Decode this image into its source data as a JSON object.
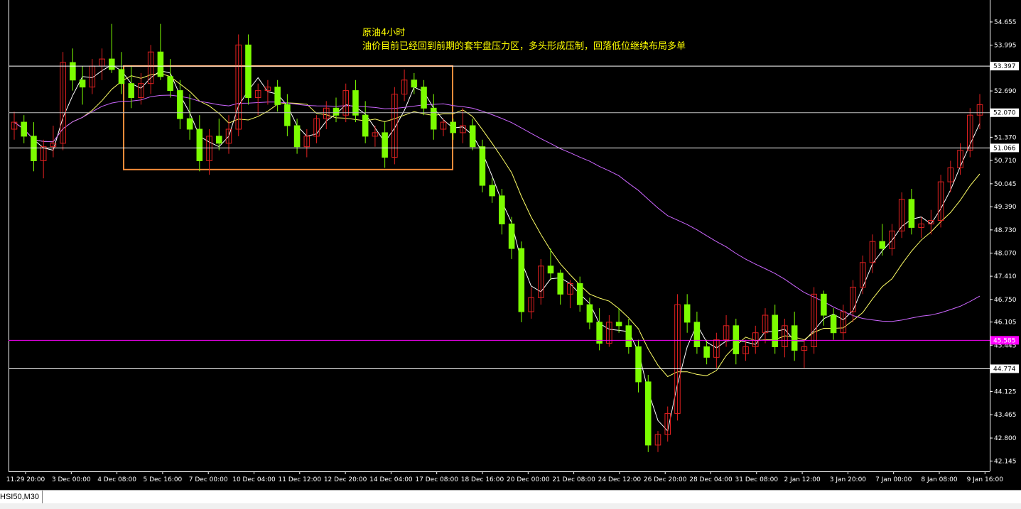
{
  "chart_data": {
    "type": "candlestick",
    "annotation": {
      "line1": "原油4小时",
      "line2": "油价目前已经回到前期的套牢盘压力区，多头形成压制，回落低位继续布局多单"
    },
    "y_ticks": [
      "54.655",
      "53.995",
      "53.397",
      "52.690",
      "52.070",
      "51.370",
      "51.066",
      "50.710",
      "50.045",
      "49.390",
      "48.730",
      "48.070",
      "47.410",
      "46.750",
      "46.105",
      "45.585",
      "45.445",
      "44.774",
      "44.125",
      "43.465",
      "42.800",
      "42.145"
    ],
    "y_ticks_plain": [
      54.655,
      53.995,
      53.335,
      52.69,
      52.03,
      51.37,
      50.71,
      50.045,
      49.39,
      48.73,
      48.07,
      47.41,
      46.75,
      46.105,
      45.445,
      44.774,
      44.125,
      43.465,
      42.8,
      42.145
    ],
    "x_labels": [
      "11.29 20:00",
      "3 Dec 00:00",
      "4 Dec 08:00",
      "5 Dec 16:00",
      "7 Dec 00:00",
      "10 Dec 04:00",
      "11 Dec 12:00",
      "12 Dec 20:00",
      "14 Dec 04:00",
      "17 Dec 08:00",
      "18 Dec 16:00",
      "20 Dec 00:00",
      "21 Dec 08:00",
      "24 Dec 12:00",
      "26 Dec 20:00",
      "28 Dec 04:00",
      "31 Dec 08:00",
      "2 Jan 12:00",
      "3 Jan 20:00",
      "7 Jan 00:00",
      "8 Jan 08:00",
      "9 Jan 16:00"
    ],
    "ylim": [
      41.85,
      55.2
    ],
    "horizontal_lines": [
      {
        "price": 53.397,
        "label": "53.397",
        "color": "#ffffff"
      },
      {
        "price": 52.07,
        "label": "52.070",
        "color": "#c0c0c0"
      },
      {
        "price": 51.066,
        "label": "51.066",
        "color": "#ffffff"
      },
      {
        "price": 45.585,
        "label": "45.585",
        "color": "#ff00ff"
      },
      {
        "price": 44.774,
        "label": "44.774",
        "color": "#ffffff"
      }
    ],
    "resistance_box": {
      "price_top": 53.4,
      "price_bottom": 50.45,
      "color": "#ff8c3a"
    },
    "ohlc": [
      [
        51.6,
        52.1,
        51.3,
        51.8
      ],
      [
        51.8,
        52.0,
        51.2,
        51.4
      ],
      [
        51.4,
        51.8,
        50.4,
        50.7
      ],
      [
        50.7,
        51.3,
        50.2,
        51.1
      ],
      [
        51.1,
        51.7,
        50.8,
        51.2
      ],
      [
        51.2,
        53.8,
        51.0,
        53.5
      ],
      [
        53.5,
        53.9,
        52.7,
        53.0
      ],
      [
        53.0,
        53.4,
        52.3,
        52.8
      ],
      [
        52.8,
        53.6,
        52.6,
        53.4
      ],
      [
        53.4,
        53.9,
        53.0,
        53.6
      ],
      [
        53.6,
        54.6,
        53.2,
        53.3
      ],
      [
        53.3,
        53.8,
        52.6,
        52.9
      ],
      [
        52.9,
        53.4,
        52.2,
        52.5
      ],
      [
        52.5,
        53.2,
        52.3,
        52.9
      ],
      [
        52.9,
        54.0,
        52.6,
        53.8
      ],
      [
        53.8,
        54.6,
        53.0,
        53.1
      ],
      [
        53.1,
        53.6,
        52.5,
        52.7
      ],
      [
        52.7,
        53.0,
        51.6,
        51.9
      ],
      [
        51.9,
        52.6,
        51.3,
        51.6
      ],
      [
        51.6,
        52.0,
        50.4,
        50.7
      ],
      [
        50.7,
        51.6,
        50.3,
        51.4
      ],
      [
        51.4,
        51.9,
        51.0,
        51.2
      ],
      [
        51.2,
        52.0,
        50.9,
        51.6
      ],
      [
        51.6,
        54.3,
        51.4,
        54.0
      ],
      [
        54.0,
        54.3,
        52.3,
        52.5
      ],
      [
        52.5,
        52.9,
        52.0,
        52.7
      ],
      [
        52.7,
        53.0,
        52.3,
        52.8
      ],
      [
        52.8,
        53.0,
        52.1,
        52.3
      ],
      [
        52.3,
        52.6,
        51.4,
        51.7
      ],
      [
        51.7,
        51.9,
        50.9,
        51.1
      ],
      [
        51.1,
        51.6,
        50.8,
        51.4
      ],
      [
        51.4,
        52.0,
        51.2,
        51.9
      ],
      [
        51.9,
        52.4,
        51.6,
        52.2
      ],
      [
        52.2,
        52.5,
        51.8,
        52.0
      ],
      [
        52.0,
        52.9,
        51.8,
        52.7
      ],
      [
        52.7,
        53.0,
        51.8,
        52.0
      ],
      [
        52.0,
        52.4,
        51.2,
        51.4
      ],
      [
        51.4,
        51.7,
        51.1,
        51.5
      ],
      [
        51.5,
        51.8,
        50.5,
        50.8
      ],
      [
        50.8,
        52.8,
        50.6,
        52.6
      ],
      [
        52.6,
        53.3,
        52.4,
        53.0
      ],
      [
        53.0,
        53.2,
        52.6,
        52.8
      ],
      [
        52.8,
        53.0,
        52.0,
        52.2
      ],
      [
        52.2,
        52.6,
        51.3,
        51.6
      ],
      [
        51.6,
        51.9,
        51.4,
        51.8
      ],
      [
        51.8,
        51.9,
        51.3,
        51.5
      ],
      [
        51.5,
        52.2,
        51.2,
        51.7
      ],
      [
        51.7,
        51.9,
        51.0,
        51.1
      ],
      [
        51.1,
        51.3,
        49.8,
        50.0
      ],
      [
        50.0,
        50.2,
        49.5,
        49.7
      ],
      [
        49.7,
        49.9,
        48.6,
        48.9
      ],
      [
        48.9,
        49.1,
        47.9,
        48.2
      ],
      [
        48.2,
        48.4,
        46.1,
        46.4
      ],
      [
        46.4,
        47.1,
        46.2,
        46.8
      ],
      [
        46.8,
        47.9,
        46.6,
        47.7
      ],
      [
        47.7,
        48.2,
        47.3,
        47.5
      ],
      [
        47.5,
        47.6,
        46.6,
        46.9
      ],
      [
        46.9,
        47.3,
        46.5,
        47.2
      ],
      [
        47.2,
        47.4,
        46.4,
        46.6
      ],
      [
        46.6,
        46.8,
        45.9,
        46.1
      ],
      [
        46.1,
        46.5,
        45.3,
        45.5
      ],
      [
        45.5,
        46.3,
        45.4,
        46.1
      ],
      [
        46.1,
        46.5,
        45.8,
        46.0
      ],
      [
        46.0,
        46.2,
        45.2,
        45.4
      ],
      [
        45.4,
        45.6,
        44.1,
        44.4
      ],
      [
        44.4,
        44.6,
        42.4,
        42.6
      ],
      [
        42.6,
        43.0,
        42.4,
        42.9
      ],
      [
        42.9,
        43.7,
        42.7,
        43.5
      ],
      [
        43.5,
        46.9,
        43.3,
        46.6
      ],
      [
        46.6,
        46.9,
        45.8,
        46.1
      ],
      [
        46.1,
        46.4,
        45.2,
        45.4
      ],
      [
        45.4,
        45.6,
        44.9,
        45.1
      ],
      [
        45.1,
        45.8,
        44.8,
        45.6
      ],
      [
        45.6,
        46.3,
        45.4,
        46.0
      ],
      [
        46.0,
        46.2,
        44.9,
        45.2
      ],
      [
        45.2,
        45.6,
        45.0,
        45.4
      ],
      [
        45.4,
        46.0,
        45.2,
        45.8
      ],
      [
        45.8,
        46.5,
        45.5,
        46.3
      ],
      [
        46.3,
        46.6,
        45.2,
        45.4
      ],
      [
        45.4,
        46.2,
        45.1,
        46.0
      ],
      [
        46.0,
        46.4,
        45.0,
        45.3
      ],
      [
        45.3,
        45.6,
        44.8,
        45.4
      ],
      [
        45.4,
        47.1,
        45.2,
        46.9
      ],
      [
        46.9,
        47.0,
        46.0,
        46.3
      ],
      [
        46.3,
        46.5,
        45.6,
        45.8
      ],
      [
        45.8,
        46.6,
        45.6,
        46.4
      ],
      [
        46.4,
        47.3,
        46.1,
        47.1
      ],
      [
        47.1,
        48.0,
        46.9,
        47.8
      ],
      [
        47.8,
        48.6,
        47.5,
        48.4
      ],
      [
        48.4,
        48.9,
        48.0,
        48.2
      ],
      [
        48.2,
        48.9,
        48.0,
        48.7
      ],
      [
        48.7,
        49.8,
        48.5,
        49.6
      ],
      [
        49.6,
        49.9,
        48.6,
        48.8
      ],
      [
        48.8,
        49.1,
        48.5,
        48.9
      ],
      [
        48.9,
        49.3,
        48.6,
        49.0
      ],
      [
        49.0,
        50.3,
        48.8,
        50.1
      ],
      [
        50.1,
        50.7,
        49.8,
        50.5
      ],
      [
        50.5,
        51.2,
        50.3,
        51.0
      ],
      [
        51.0,
        52.2,
        50.8,
        52.0
      ],
      [
        52.0,
        52.6,
        51.6,
        52.3
      ]
    ]
  }
}
